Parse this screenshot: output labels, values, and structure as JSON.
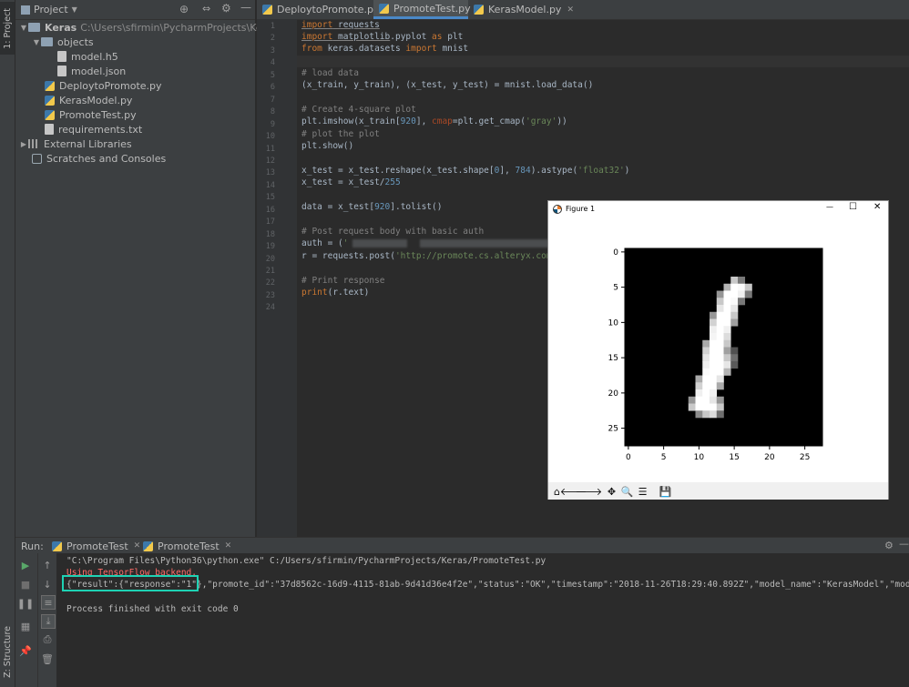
{
  "side_tabs": {
    "project": "1: Project",
    "structure": "Z: Structure"
  },
  "project_panel": {
    "title": "Project",
    "tree": [
      {
        "label": "Keras",
        "path": "C:\\Users\\sfirmin\\PycharmProjects\\Keras",
        "kind": "folder",
        "expanded": true
      },
      {
        "label": "objects",
        "kind": "folder",
        "expanded": true
      },
      {
        "label": "model.h5",
        "kind": "file"
      },
      {
        "label": "model.json",
        "kind": "file"
      },
      {
        "label": "DeploytoPromote.py",
        "kind": "python"
      },
      {
        "label": "KerasModel.py",
        "kind": "python"
      },
      {
        "label": "PromoteTest.py",
        "kind": "python"
      },
      {
        "label": "requirements.txt",
        "kind": "file"
      },
      {
        "label": "External Libraries",
        "kind": "library"
      },
      {
        "label": "Scratches and Consoles",
        "kind": "scratch"
      }
    ]
  },
  "editor": {
    "tabs": [
      {
        "label": "DeploytoPromote.py",
        "active": false
      },
      {
        "label": "PromoteTest.py",
        "active": true
      },
      {
        "label": "KerasModel.py",
        "active": false
      }
    ],
    "line_numbers": [
      "1",
      "2",
      "3",
      "4",
      "5",
      "6",
      "7",
      "8",
      "9",
      "10",
      "11",
      "12",
      "13",
      "14",
      "15",
      "16",
      "17",
      "18",
      "19",
      "20",
      "21",
      "22",
      "23",
      "24"
    ],
    "code": {
      "l1_kw": "import",
      "l1_rest": " requests",
      "l2_kw": "import",
      "l2_mod": " matplotlib",
      "l2_mid": ".pyplot ",
      "l2_as": "as",
      "l2_rest": " plt",
      "l3_kw": "from",
      "l3_mid": " keras.datasets ",
      "l3_kw2": "import",
      "l3_rest": " mnist",
      "l5": "# load data",
      "l6": "(x_train, y_train), (x_test, y_test) = mnist.load_data()",
      "l8": "# Create 4-square plot",
      "l9_a": "plt.imshow(x_train[",
      "l9_n": "920",
      "l9_b": "], ",
      "l9_kw": "cmap",
      "l9_c": "=plt.get_cmap(",
      "l9_s": "'gray'",
      "l9_d": "))",
      "l10": "# plot the plot",
      "l11": "plt.show()",
      "l13_a": "x_test = x_test.reshape(x_test.shape[",
      "l13_n1": "0",
      "l13_b": "], ",
      "l13_n2": "784",
      "l13_c": ").astype(",
      "l13_s": "'float32'",
      "l13_d": ")",
      "l14_a": "x_test = x_test/",
      "l14_n": "255",
      "l16_a": "data = x_test[",
      "l16_n": "920",
      "l16_b": "].tolist()",
      "l18": "# Post request body with basic auth",
      "l19_a": "auth = (",
      "l19_s": "'",
      "l20_a": "r = requests.post(",
      "l20_s": "'http://promote.cs.alteryx.com/",
      "l22": "# Print response",
      "l23_kw": "print",
      "l23_rest": "(r.text)"
    }
  },
  "figure": {
    "title": "Figure 1",
    "controls": {
      "minimize": "—",
      "maximize": "☐",
      "close": "✕"
    },
    "y_ticks": [
      "0",
      "5",
      "10",
      "15",
      "20",
      "25"
    ],
    "x_ticks": [
      "0",
      "5",
      "10",
      "15",
      "20",
      "25"
    ],
    "image_desc_pixels": "mnist digit 1 (index 920) in gray colormap, 28x28"
  },
  "run_panel": {
    "label": "Run:",
    "tabs": [
      "PromoteTest",
      "PromoteTest"
    ],
    "lines": {
      "cmd": "\"C:\\Program Files\\Python36\\python.exe\" C:/Users/sfirmin/PycharmProjects/Keras/PromoteTest.py",
      "tf": "Using TensorFlow backend.",
      "result_hl": "{\"result\":{\"response\":\"1\"}",
      "result_rest": ",\"promote_id\":\"37d8562c-16d9-4115-81ab-9d41d36e4f2e\",\"status\":\"OK\",\"timestamp\":\"2018-11-26T18:29:40.892Z\",\"model_name\":\"KerasModel\",\"model_v",
      "exit": "Process finished with exit code 0"
    }
  },
  "colors": {
    "accent": "#4a88c7",
    "highlight_box": "#1ed2b4",
    "error_text": "#ff6b68"
  }
}
